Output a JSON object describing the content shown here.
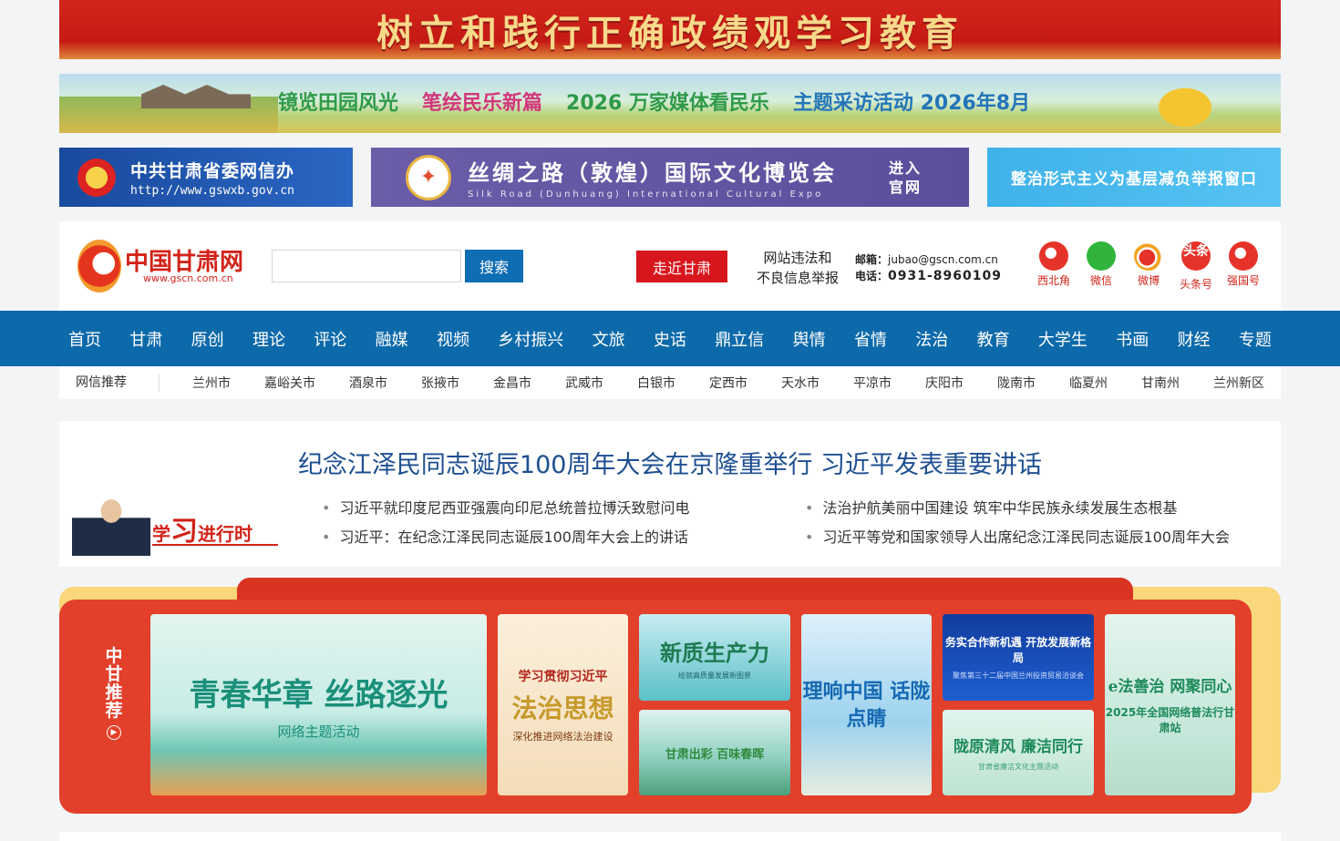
{
  "banner_top": {
    "text": "树立和践行正确政绩观学习教育"
  },
  "banner_land": {
    "t1": "镜览田园风光",
    "t2": "笔绘民乐新篇",
    "t3": "2026 万家媒体看民乐",
    "t4": "主题采访活动 2026年8月"
  },
  "ads": {
    "ad1": {
      "title": "中共甘肃省委网信办",
      "url": "http://www.gswxb.gov.cn"
    },
    "ad2": {
      "title": "丝绸之路（敦煌）国际文化博览会",
      "subtitle": "Silk Road (Dunhuang) International Cultural Expo",
      "enter": "进入官网"
    },
    "ad3": {
      "title": "整治形式主义为基层减负举报窗口"
    }
  },
  "header": {
    "logo_text": "中国甘肃网",
    "logo_url": "www.gscn.com.cn",
    "search_placeholder": "",
    "search_button": "搜索",
    "zoujin_button": "走近甘肃",
    "report_line1": "网站违法和",
    "report_line2": "不良信息举报",
    "email_label": "邮箱：",
    "email": "jubao@gscn.com.cn",
    "phone_label": "电话：",
    "phone": "0931-8960109",
    "socials": [
      {
        "label": "西北角"
      },
      {
        "label": "微信"
      },
      {
        "label": "微博"
      },
      {
        "label": "头条号",
        "icon_text": "头条"
      },
      {
        "label": "强国号"
      }
    ]
  },
  "nav": [
    "首页",
    "甘肃",
    "原创",
    "理论",
    "评论",
    "融媒",
    "视频",
    "乡村振兴",
    "文旅",
    "史话",
    "鼎立信",
    "舆情",
    "省情",
    "法治",
    "教育",
    "大学生",
    "书画",
    "财经",
    "专题"
  ],
  "subnav": {
    "label": "网信推荐",
    "cities": [
      "兰州市",
      "嘉峪关市",
      "酒泉市",
      "张掖市",
      "金昌市",
      "武威市",
      "白银市",
      "定西市",
      "天水市",
      "平凉市",
      "庆阳市",
      "陇南市",
      "临夏州",
      "甘南州",
      "兰州新区"
    ]
  },
  "headline": {
    "title": "纪念江泽民同志诞辰100周年大会在京隆重举行 习近平发表重要讲话",
    "xi_title_a": "学",
    "xi_title_b": "习",
    "xi_title_c": "进行时",
    "left_items": [
      "习近平就印度尼西亚强震向印尼总统普拉博沃致慰问电",
      "习近平：在纪念江泽民同志诞辰100周年大会上的讲话"
    ],
    "right_items": [
      "法治护航美丽中国建设 筑牢中华民族永续发展生态根基",
      "习近平等党和国家领导人出席纪念江泽民同志诞辰100周年大会"
    ]
  },
  "recommend": {
    "label": "中甘推荐",
    "cards": {
      "c1_title": "青春华章 丝路逐光",
      "c1_sub": "网络主题活动",
      "c2_a": "学习贯彻习近平",
      "c2_b": "法治思想",
      "c2_c": "深化推进网络法治建设",
      "c3_title": "新质生产力",
      "c3_sub": "绘就高质量发展新图景",
      "c4_title": "甘肃出彩 百味春晖",
      "c5_title": "理响中国 话陇点睛",
      "c6_title": "务实合作新机遇 开放发展新格局",
      "c6_sub": "聚焦第三十二届中国兰州投资贸易洽谈会",
      "c7_title": "陇原清风 廉洁同行",
      "c7_sub": "甘肃省廉洁文化主题活动",
      "c8_title": "e法善治 网聚同心",
      "c8_sub": "2025年全国网络普法行甘肃站"
    }
  }
}
